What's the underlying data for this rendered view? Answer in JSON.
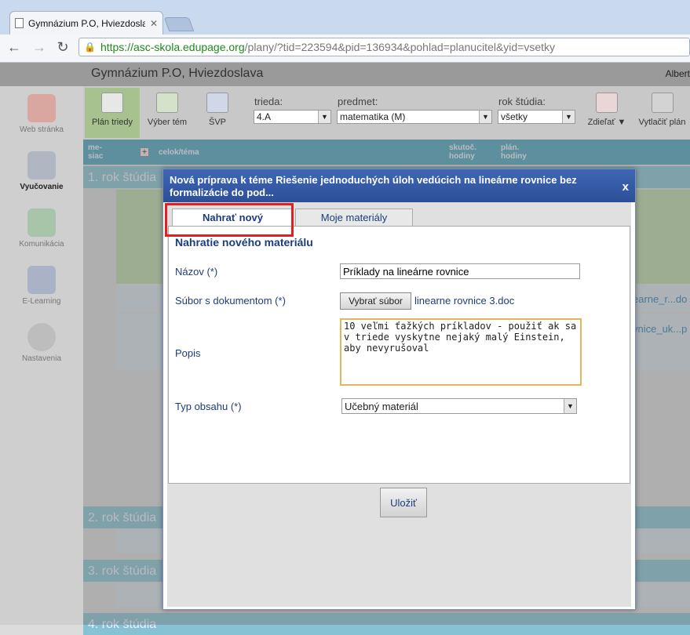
{
  "browser": {
    "tab_title": "Gymnázium P.O, Hviezdoslava",
    "url_scheme": "https://",
    "url_host": "asc-skola.edupage.org",
    "url_path": "/plany/?tid=223594&pid=136934&pohlad=planucitel&yid=vsetky"
  },
  "page": {
    "school_name": "Gymnázium P.O, Hviezdoslava",
    "user_name": "Albert"
  },
  "leftnav": {
    "items": [
      {
        "label": "Web stránka"
      },
      {
        "label": "Vyučovanie"
      },
      {
        "label": "Komunikácia"
      },
      {
        "label": "E-Learning"
      },
      {
        "label": "Nastavenia"
      }
    ]
  },
  "toolbar": {
    "plan_label": "Plán triedy",
    "select_label": "Výber tém",
    "svp_label": "ŠVP",
    "class_label": "trieda:",
    "class_value": "4.A",
    "subject_label": "predmet:",
    "subject_value": "matematika (M)",
    "year_label": "rok štúdia:",
    "year_value": "všetky",
    "share_label": "Zdieľať ▼",
    "print_label": "Vytlačiť plán"
  },
  "table": {
    "col_month": "me-\nsiac",
    "col_topic": "celok/téma",
    "col_actual": "skutoč.\nhodiny",
    "col_planned": "plán.\nhodiny",
    "row1": "1. rok štúdia",
    "row2": "2. rok štúdia",
    "row3": "3. rok štúdia",
    "row4": "4. rok štúdia",
    "link1": "earne_r...do",
    "link2": "vnice_uk...p"
  },
  "dialog": {
    "title": "Nová príprava k téme Riešenie jednoduchých úloh vedúcich na lineárne rovnice bez formalizácie do pod...",
    "close": "x",
    "tab_new": "Nahrať nový",
    "tab_mine": "Moje materiály",
    "panel_title": "Nahratie nového materiálu",
    "name_label": "Názov (*)",
    "name_value": "Príklady na lineárne rovnice",
    "file_label": "Súbor s dokumentom (*)",
    "file_button": "Vybrať súbor",
    "file_name": "linearne rovnice 3.doc",
    "desc_label": "Popis",
    "desc_value": "10 veľmi ťažkých príkladov - použiť ak sa v triede vyskytne nejaký malý Einstein, aby nevyrušoval",
    "type_label": "Typ obsahu (*)",
    "type_value": "Učebný materiál",
    "save_button": "Uložiť"
  }
}
